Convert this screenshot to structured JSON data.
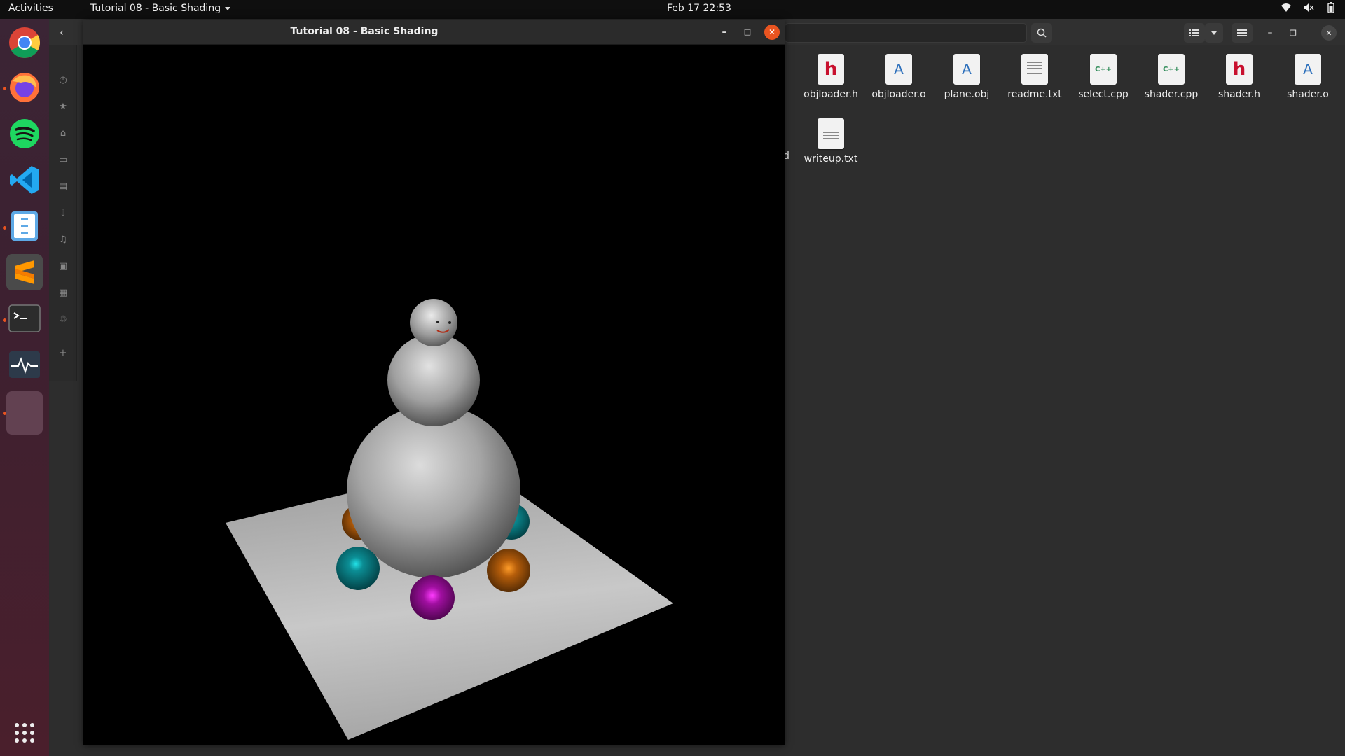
{
  "topbar": {
    "activities": "Activities",
    "app_menu": "Tutorial 08 - Basic Shading",
    "clock": "Feb 17  22:53"
  },
  "dock": {
    "apps": [
      {
        "name": "chrome-icon"
      },
      {
        "name": "firefox-icon"
      },
      {
        "name": "spotify-icon"
      },
      {
        "name": "vscode-icon"
      },
      {
        "name": "files-icon"
      },
      {
        "name": "sublime-text-icon"
      },
      {
        "name": "terminal-icon"
      },
      {
        "name": "system-monitor-icon"
      },
      {
        "name": "running-app-icon"
      }
    ],
    "show_apps": "show-applications-icon"
  },
  "gl_window": {
    "title": "Tutorial 08 - Basic Shading"
  },
  "file_manager": {
    "files": [
      {
        "name": "objloader.h",
        "kind": "h"
      },
      {
        "name": "objloader.o",
        "kind": "doc"
      },
      {
        "name": "plane.obj",
        "kind": "doc"
      },
      {
        "name": "readme.txt",
        "kind": "txt"
      },
      {
        "name": "select.cpp",
        "kind": "cpp"
      },
      {
        "name": "shader.cpp",
        "kind": "cpp"
      },
      {
        "name": "shader.h",
        "kind": "h"
      },
      {
        "name": "shader.o",
        "kind": "doc"
      },
      {
        "name": "writeup.txt",
        "kind": "txt"
      }
    ],
    "cpp_glyph": "C++",
    "h_glyph": "h",
    "doc_glyph": "A",
    "partial_labels": [
      ".",
      "d"
    ]
  },
  "colors": {
    "accent": "#e95420",
    "teal_ball": "#0a7f86",
    "orange_ball": "#c96a0c",
    "purple_ball": "#a50fa5"
  }
}
